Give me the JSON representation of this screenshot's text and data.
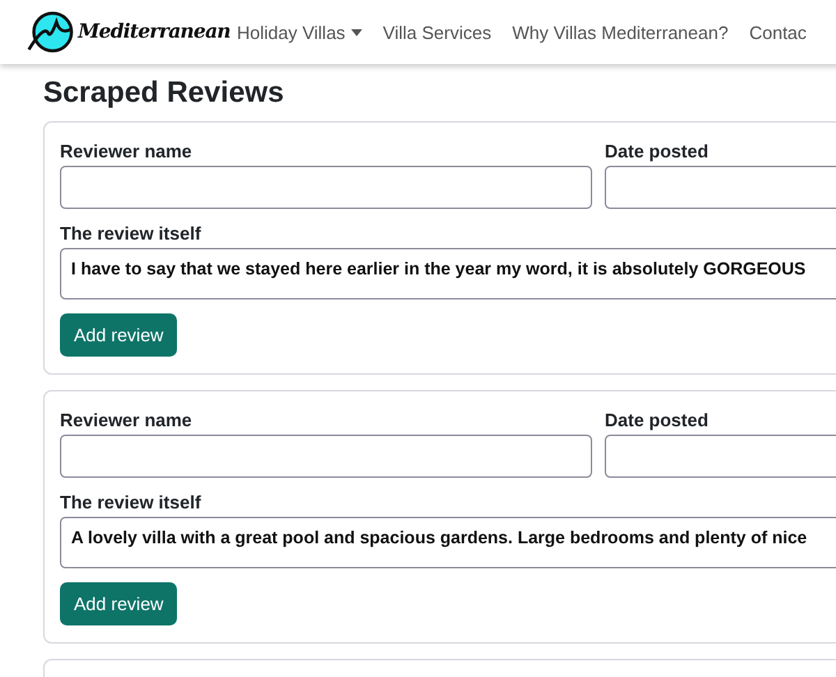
{
  "logo": {
    "text": "Mediterranean"
  },
  "nav": [
    {
      "label": "Holiday Villas",
      "dropdown": true
    },
    {
      "label": "Villa Services",
      "dropdown": false
    },
    {
      "label": "Why Villas Mediterranean?",
      "dropdown": false
    },
    {
      "label": "Contac",
      "dropdown": false
    }
  ],
  "heading": "Scraped Reviews",
  "reviews": [
    {
      "name_label": "Reviewer name",
      "date_label": "Date posted",
      "review_label": "The review itself",
      "review": "I have to say that we stayed here earlier in the year my word, it is absolutely GORGEOUS",
      "button": "Add review"
    },
    {
      "name_label": "Reviewer name",
      "date_label": "Date posted",
      "review_label": "The review itself",
      "review": "A lovely villa with a great pool and spacious gardens. Large bedrooms and plenty of nice",
      "button": "Add review"
    }
  ]
}
